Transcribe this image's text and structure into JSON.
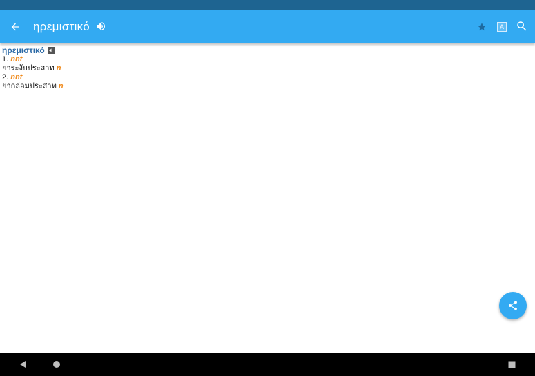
{
  "app_bar": {
    "title": "ηρεμιστικό",
    "icons": {
      "back": "arrow-left-icon",
      "speaker": "speaker-icon",
      "favorite": "star-icon",
      "font": "font-size-icon",
      "search": "search-icon"
    },
    "font_icon_letter": "A"
  },
  "entry": {
    "headword": "ηρεμιστικό",
    "senses": [
      {
        "number": "1.",
        "pos": "nnt",
        "translation": "ยาระงับประสาท",
        "tag": "n"
      },
      {
        "number": "2.",
        "pos": "nnt",
        "translation": "ยากล่อมประสาท",
        "tag": "n"
      }
    ]
  },
  "fab": {
    "icon": "share-icon"
  },
  "colors": {
    "status_bar": "#1e6491",
    "app_bar": "#33aaf2",
    "headword": "#2c6aa6",
    "pos": "#f08a1c"
  }
}
